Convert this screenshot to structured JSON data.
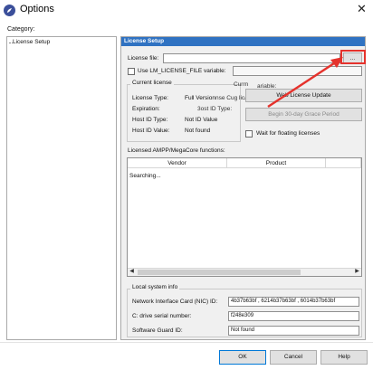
{
  "window": {
    "title": "Options",
    "close_glyph": "✕"
  },
  "category": {
    "label": "Category:",
    "items": [
      {
        "label": "License Setup",
        "selected": true
      }
    ]
  },
  "panel": {
    "header": "License Setup",
    "license_file": {
      "label": "License file:",
      "value": "",
      "browse_label": "..."
    },
    "lm_license": {
      "checkbox_label": "Use LM_LICENSE_FILE variable:",
      "checked": false,
      "value": ""
    },
    "current_license": {
      "legend": "Current license",
      "rows": [
        {
          "label": "License Type:",
          "value": "Full Version"
        },
        {
          "label": "Expiration:",
          "value": ""
        },
        {
          "label": "Host ID Type:",
          "value": "Not ID Value"
        },
        {
          "label": "Host ID Value:",
          "value": "Not found"
        }
      ],
      "overlap_fragments": [
        "Currn",
        "ariable:",
        "nse Cug licas",
        "3ost ID Type:",
        "Not ID Value"
      ]
    },
    "web_update_button": "Web License Update",
    "grace_period_button": "Begin 30-day Grace Period",
    "wait_floating": {
      "label": "Wait for floating licenses",
      "checked": false
    },
    "functions": {
      "label": "Licensed AMPP/MegaCore functions:",
      "columns": [
        "Vendor",
        "Product",
        ""
      ],
      "rows": [
        "Searching..."
      ]
    },
    "system_info": {
      "legend": "Local system info",
      "nic": {
        "label": "Network Interface Card (NIC) ID:",
        "value": "4b37b63bf , 6214b37b63bf , 6014b37b63bf"
      },
      "cdrive": {
        "label": "C: drive serial number:",
        "value": "f248e309"
      },
      "guard": {
        "label": "Software Guard ID:",
        "value": "Not found"
      }
    }
  },
  "buttons": {
    "ok": "OK",
    "cancel": "Cancel",
    "help": "Help"
  },
  "annotation": {
    "color": "#e5322c",
    "icons": [
      "red-highlight-box",
      "red-arrow-icon"
    ]
  },
  "colors": {
    "header_blue": "#2f72c2",
    "panel_bg": "#f0f0f0"
  }
}
